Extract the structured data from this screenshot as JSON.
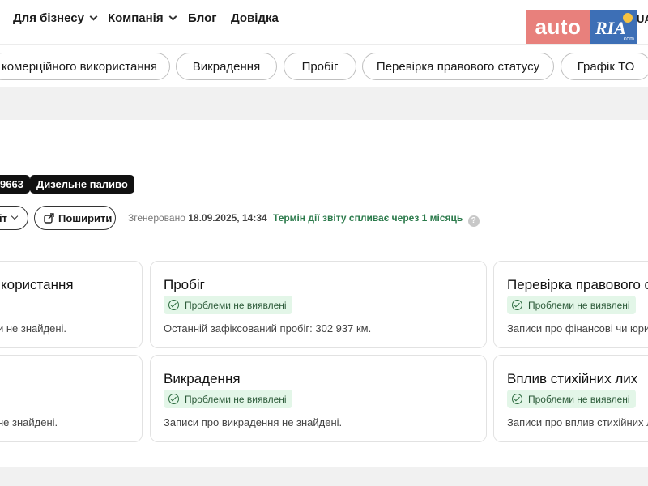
{
  "header": {
    "nav": [
      {
        "label": "Для бізнесу",
        "has_dropdown": true
      },
      {
        "label": "Компанія",
        "has_dropdown": true
      },
      {
        "label": "Блог",
        "has_dropdown": false
      },
      {
        "label": "Довідка",
        "has_dropdown": false
      }
    ],
    "logo": {
      "part1": "auto",
      "part2": "RIA",
      "part2_suffix": ".com"
    },
    "lang": "UA"
  },
  "categories": [
    "комерційного використання",
    "Викрадення",
    "Пробіг",
    "Перевірка правового статусу",
    "Графік ТО"
  ],
  "tags": [
    "9663",
    "Дизельне паливо"
  ],
  "actions": {
    "partial_label": "іт",
    "share_label": "Поширити"
  },
  "report": {
    "generated_label": "Згенеровано",
    "generated_date": "18.09.2025, 14:34",
    "expiry": "Термін дії звіту спливає через 1 місяць",
    "help": "?"
  },
  "cards": [
    {
      "title": "користання",
      "badge": "",
      "desc": "и не знайдені."
    },
    {
      "title": "Пробіг",
      "badge": "Проблеми не виявлені",
      "desc": "Останній зафіксований пробіг: 302 937 км."
    },
    {
      "title": "Перевірка правового с",
      "badge": "Проблеми не виявлені",
      "desc": "Записи про фінансові чи юри"
    },
    {
      "title": "",
      "badge": "",
      "desc": "не знайдені."
    },
    {
      "title": "Викрадення",
      "badge": "Проблеми не виявлені",
      "desc": "Записи про викрадення не знайдені."
    },
    {
      "title": "Вплив стихійних лих",
      "badge": "Проблеми не виявлені",
      "desc": "Записи про вплив стихійних л"
    }
  ],
  "colors": {
    "accent_green": "#2b7a4b",
    "badge_bg": "#e3f6e8",
    "logo_auto": "#e8807c",
    "logo_ria": "#3d6fb6"
  }
}
